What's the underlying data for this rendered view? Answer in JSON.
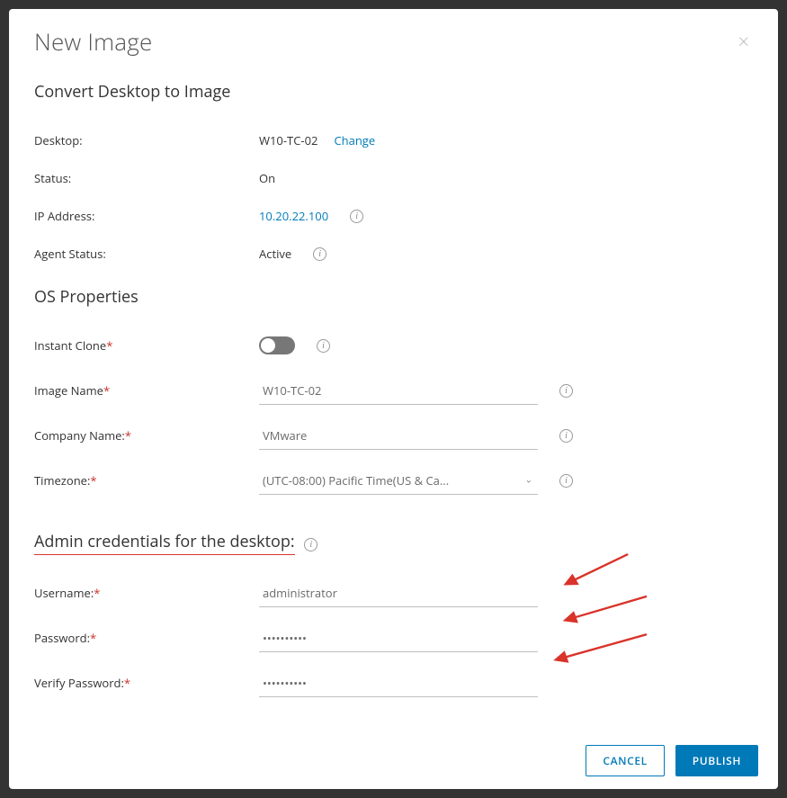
{
  "dialog": {
    "title": "New Image"
  },
  "convert": {
    "heading": "Convert Desktop to Image",
    "desktop_label": "Desktop:",
    "desktop_value": "W10-TC-02",
    "desktop_change": "Change",
    "status_label": "Status:",
    "status_value": "On",
    "ip_label": "IP Address:",
    "ip_value": "10.20.22.100",
    "agent_label": "Agent Status:",
    "agent_value": "Active"
  },
  "os": {
    "heading": "OS Properties",
    "instant_clone_label": "Instant Clone",
    "image_name_label": "Image Name",
    "image_name_value": "W10-TC-02",
    "company_label": "Company Name:",
    "company_value": "VMware",
    "tz_label": "Timezone:",
    "tz_value": "(UTC-08:00) Pacific Time(US & Ca..."
  },
  "creds": {
    "heading": "Admin credentials for the desktop:",
    "username_label": "Username:",
    "username_value": "administrator",
    "password_label": "Password:",
    "password_value": "••••••••••",
    "verify_label": "Verify Password:",
    "verify_value": "••••••••••"
  },
  "footer": {
    "cancel": "CANCEL",
    "publish": "PUBLISH"
  },
  "annotations": {
    "underline_color": "#d9332a",
    "arrow_color": "#d9332a"
  }
}
